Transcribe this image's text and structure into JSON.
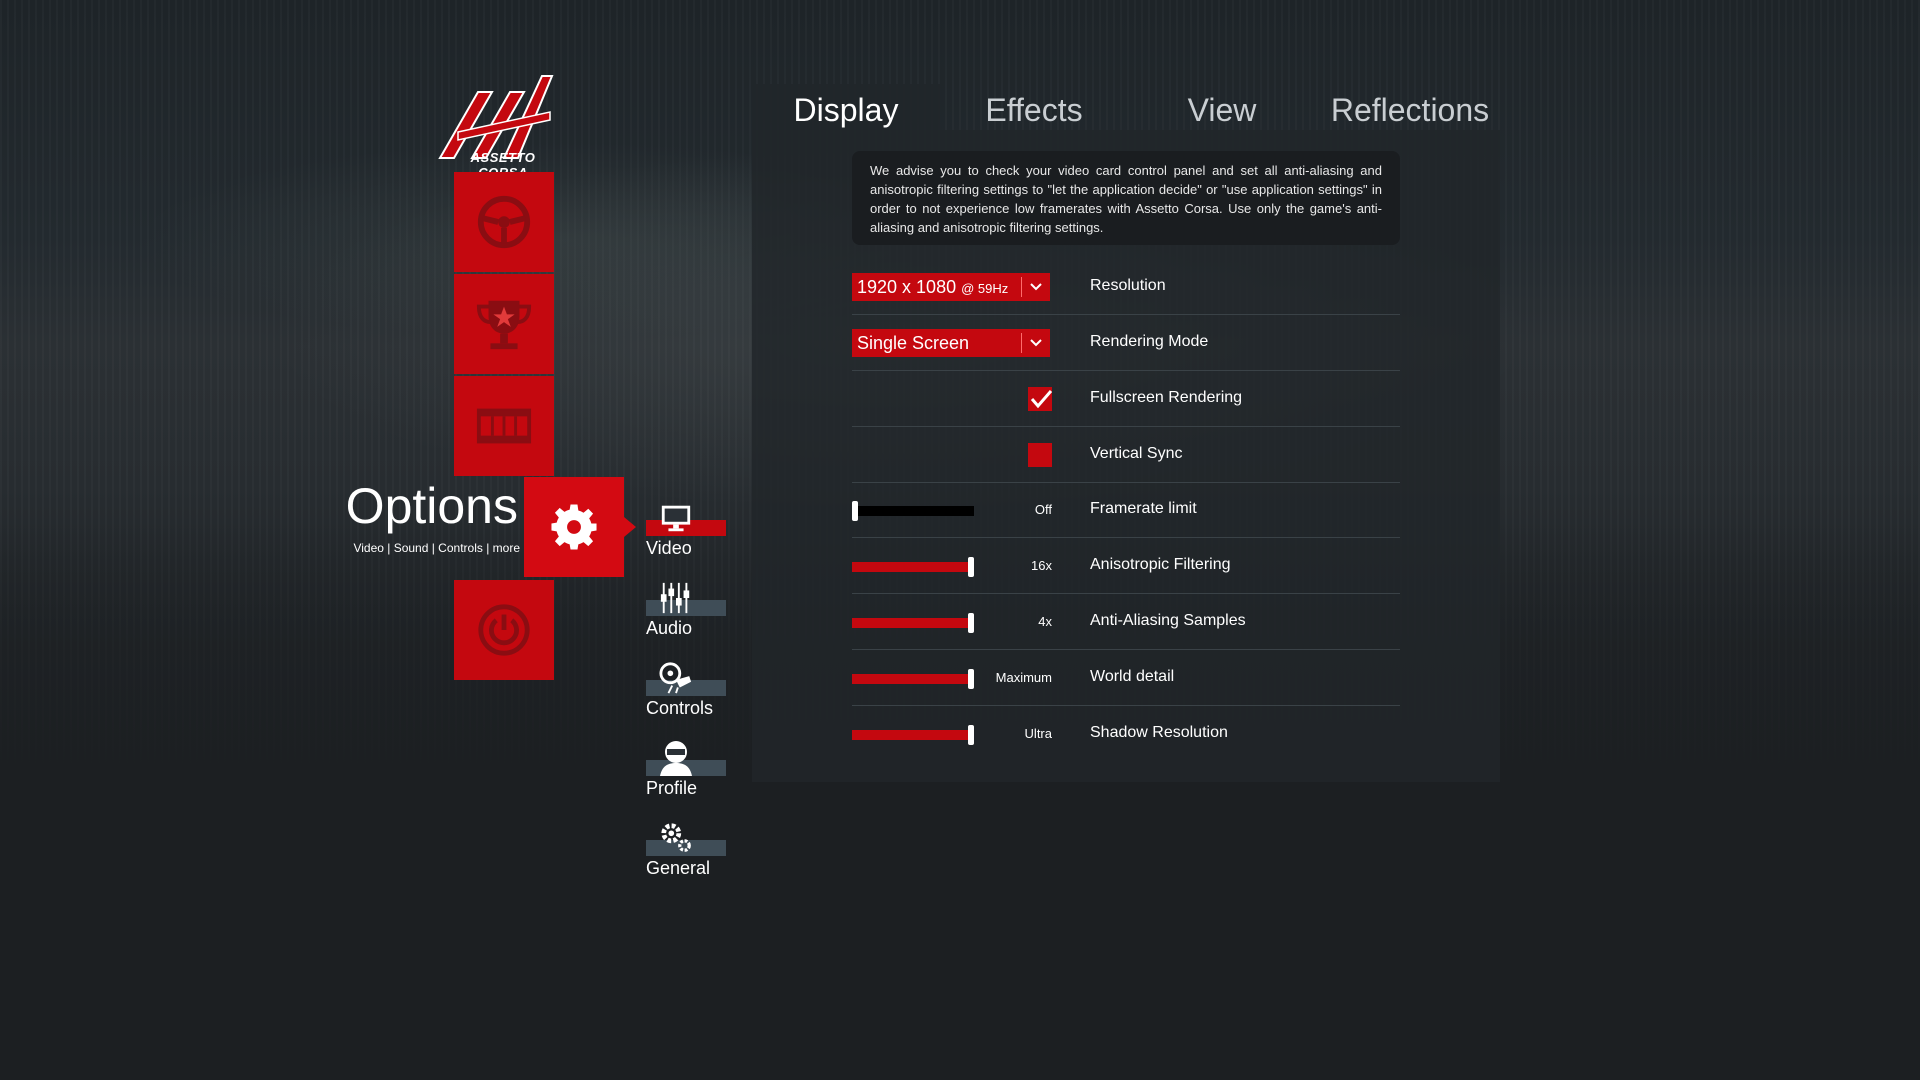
{
  "brand": {
    "logo_text": "ASSETTO CORSA",
    "accent_color": "#c4080f"
  },
  "left_menu": {
    "tiles": [
      {
        "icon": "steering-wheel-icon"
      },
      {
        "icon": "trophy-icon"
      },
      {
        "icon": "film-strip-icon"
      },
      {
        "icon": "gear-icon"
      },
      {
        "icon": "power-icon"
      }
    ],
    "active_title": "Options",
    "active_subtitle": "Video | Sound | Controls | more"
  },
  "sub_menu": [
    {
      "label": "Video",
      "icon": "monitor-icon",
      "active": true
    },
    {
      "label": "Audio",
      "icon": "mixer-icon",
      "active": false
    },
    {
      "label": "Controls",
      "icon": "controller-icon",
      "active": false
    },
    {
      "label": "Profile",
      "icon": "driver-icon",
      "active": false
    },
    {
      "label": "General",
      "icon": "gears-icon",
      "active": false
    }
  ],
  "tabs": [
    {
      "label": "Display",
      "active": true
    },
    {
      "label": "Effects",
      "active": false
    },
    {
      "label": "View",
      "active": false
    },
    {
      "label": "Reflections",
      "active": false
    }
  ],
  "notice": "We advise you to check your video card control panel and set all anti-aliasing and anisotropic filtering settings to \"let the application decide\" or \"use application settings\" in order to not experience low framerates with Assetto Corsa. Use only the game's anti-aliasing and anisotropic filtering settings.",
  "settings": {
    "resolution": {
      "value": "1920 x 1080",
      "refresh": "@ 59Hz",
      "label": "Resolution"
    },
    "rendering_mode": {
      "value": "Single Screen",
      "label": "Rendering Mode"
    },
    "fullscreen": {
      "checked": true,
      "label": "Fullscreen Rendering"
    },
    "vsync": {
      "checked": false,
      "label": "Vertical Sync"
    },
    "sliders": [
      {
        "label": "Framerate limit",
        "value_text": "Off",
        "level": 0.0
      },
      {
        "label": "Anisotropic Filtering",
        "value_text": "16x",
        "level": 1.0
      },
      {
        "label": "Anti-Aliasing Samples",
        "value_text": "4x",
        "level": 1.0
      },
      {
        "label": "World detail",
        "value_text": "Maximum",
        "level": 1.0
      },
      {
        "label": "Shadow Resolution",
        "value_text": "Ultra",
        "level": 1.0
      }
    ]
  }
}
